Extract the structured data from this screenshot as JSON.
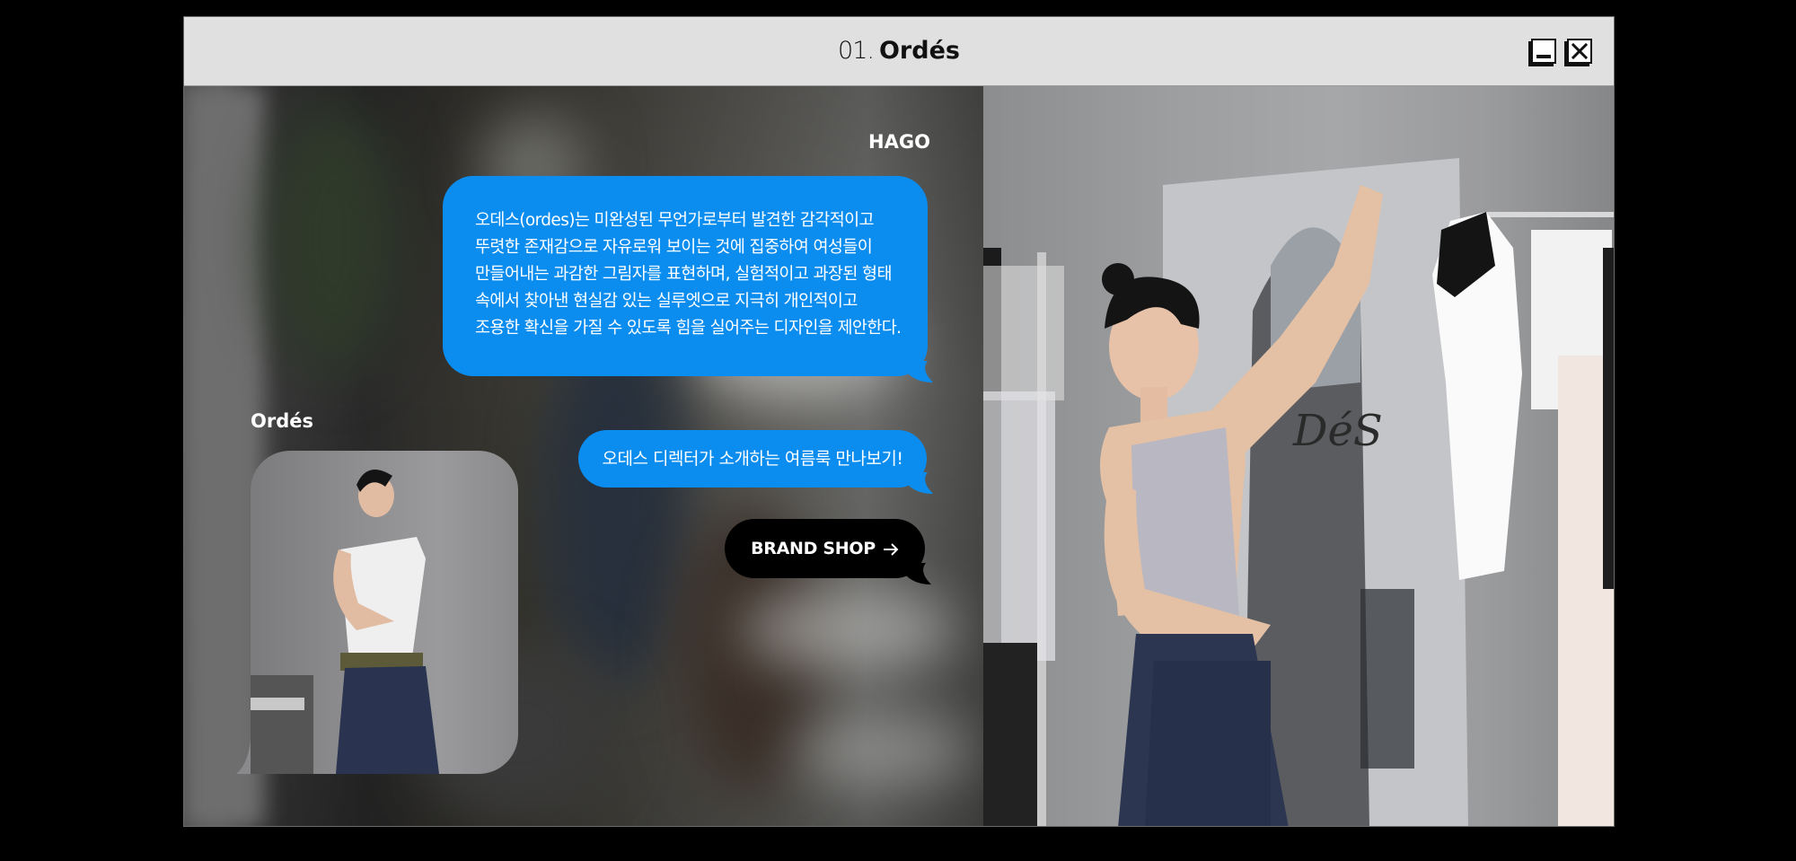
{
  "window": {
    "title_number": "01.",
    "title_name": "Ordés"
  },
  "chat": {
    "sender_hago": "HAGO",
    "sender_ordes": "Ordés",
    "message_lines": [
      "오데스(ordes)는 미완성된 무언가로부터 발견한 감각적이고",
      "뚜렷한 존재감으로 자유로워 보이는 것에 집중하여 여성들이",
      "만들어내는 과감한 그림자를 표현하며, 실험적이고 과장된 형태",
      "속에서 찾아낸 현실감 있는 실루엣으로 지극히 개인적이고",
      "조용한 확신을 가질 수 있도록 힘을 실어주는 디자인을 제안한다."
    ],
    "message_short": "오데스 디렉터가 소개하는 여름룩 만나보기!",
    "brand_shop_label": "BRAND SHOP"
  },
  "photo_sign_text": "DéS",
  "colors": {
    "bubble": "#0b8df0",
    "titlebar": "#e0e0e0",
    "button": "#000000"
  }
}
